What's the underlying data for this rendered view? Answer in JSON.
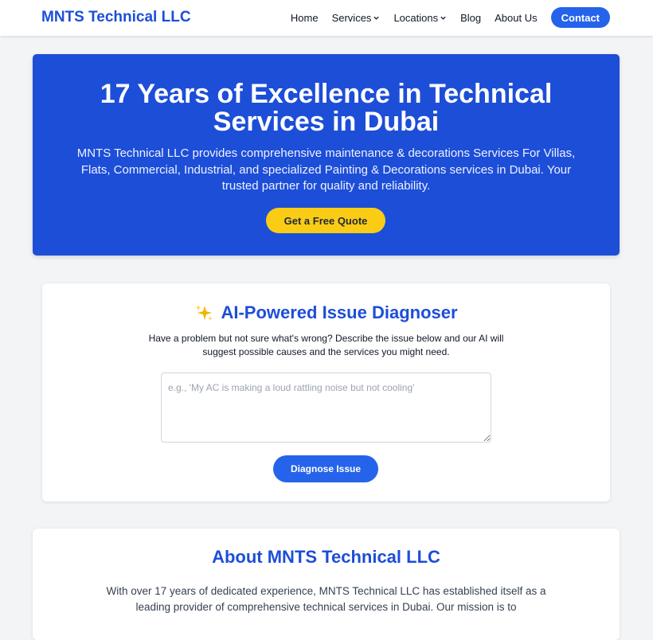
{
  "navbar": {
    "brand": "MNTS Technical LLC",
    "links": [
      {
        "label": "Home",
        "dropdown": false
      },
      {
        "label": "Services",
        "dropdown": true
      },
      {
        "label": "Locations",
        "dropdown": true
      },
      {
        "label": "Blog",
        "dropdown": false
      },
      {
        "label": "About Us",
        "dropdown": false
      }
    ],
    "contact_label": "Contact"
  },
  "hero": {
    "title": "17 Years of Excellence in Technical Services in Dubai",
    "description": "MNTS Technical LLC provides comprehensive maintenance & decorations Services For Villas, Flats, Commercial, Industrial, and specialized Painting & Decorations services in Dubai. Your trusted partner for quality and reliability.",
    "cta_label": "Get a Free Quote"
  },
  "diagnoser": {
    "icon": "sparkle-icon",
    "title": "AI-Powered Issue Diagnoser",
    "description": "Have a problem but not sure what's wrong? Describe the issue below and our AI will suggest possible causes and the services you might need.",
    "input_placeholder": "e.g., 'My AC is making a loud rattling noise but not cooling'",
    "input_value": "",
    "button_label": "Diagnose Issue"
  },
  "about": {
    "title": "About MNTS Technical LLC",
    "text": "With over 17 years of dedicated experience, MNTS Technical LLC has established itself as a leading provider of comprehensive technical services in Dubai. Our mission is to"
  },
  "colors": {
    "brand_blue": "#1d4ed8",
    "button_blue": "#2563eb",
    "cta_yellow": "#facc15",
    "page_bg": "#f3f4f6"
  }
}
